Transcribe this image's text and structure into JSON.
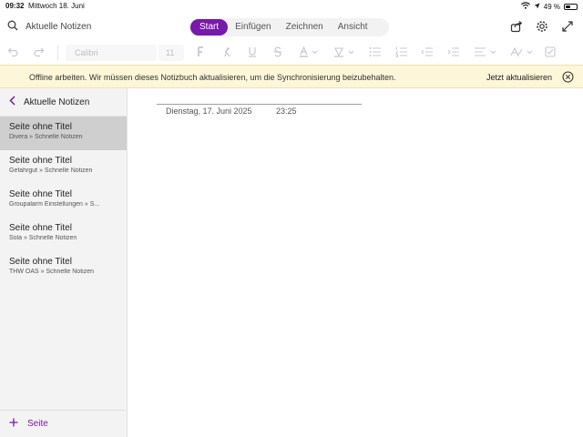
{
  "status_bar": {
    "time": "09:32",
    "date": "Mittwoch 18. Juni",
    "battery": "49 %",
    "battery_level_pct": 49
  },
  "header": {
    "search_label": "Aktuelle Notizen",
    "tabs": [
      {
        "label": "Start",
        "active": true
      },
      {
        "label": "Einfügen",
        "active": false
      },
      {
        "label": "Zeichnen",
        "active": false
      },
      {
        "label": "Ansicht",
        "active": false
      }
    ],
    "accent_color": "#7719aa",
    "icons": [
      "share-icon",
      "settings-gear-icon",
      "expand-icon"
    ]
  },
  "toolbar": {
    "font_name": "Calibri",
    "font_size": "11",
    "buttons": [
      "undo-icon",
      "redo-icon",
      "bold-icon",
      "italic-icon",
      "underline-icon",
      "strikethrough-icon",
      "font-color-icon",
      "highlight-icon",
      "bullets-icon",
      "numbering-icon",
      "outdent-icon",
      "indent-icon",
      "align-icon",
      "styles-icon",
      "checkbox-icon"
    ]
  },
  "banner": {
    "message": "Offline arbeiten. Wir müssen dieses Notizbuch aktualisieren, um die Synchronisierung beizubehalten.",
    "action": "Jetzt aktualisieren",
    "background": "#fdf6d8"
  },
  "sidebar": {
    "title": "Aktuelle Notizen",
    "pages": [
      {
        "title": "Seite ohne Titel",
        "subtitle": "Divera » Schnelle Notizen",
        "selected": true
      },
      {
        "title": "Seite ohne Titel",
        "subtitle": "Gefahrgut » Schnelle Notizen",
        "selected": false
      },
      {
        "title": "Seite ohne Titel",
        "subtitle": "Groupalarm Einstellungen » S...",
        "selected": false
      },
      {
        "title": "Seite ohne Titel",
        "subtitle": "Sola » Schnelle Notizen",
        "selected": false
      },
      {
        "title": "Seite ohne Titel",
        "subtitle": "THW OAS » Schnelle Notizen",
        "selected": false
      }
    ],
    "add_page_label": "Seite"
  },
  "note": {
    "date": "Dienstag, 17. Juni 2025",
    "time": "23:25"
  }
}
